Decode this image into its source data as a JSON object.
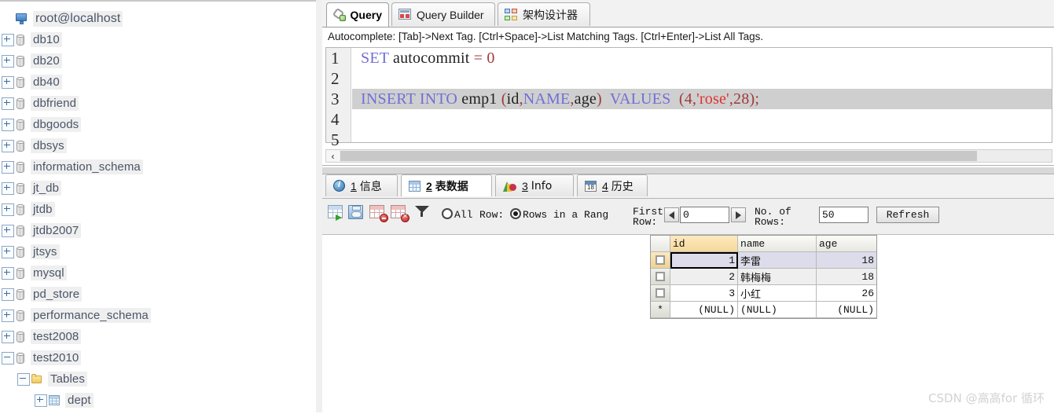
{
  "sidebar": {
    "root": {
      "label": "root@localhost",
      "icon": "monitor-icon",
      "expanded": true
    },
    "databases": [
      {
        "label": "db10",
        "icon": "database-icon",
        "toggle": "plus"
      },
      {
        "label": "db20",
        "icon": "database-icon",
        "toggle": "plus"
      },
      {
        "label": "db40",
        "icon": "database-icon",
        "toggle": "plus"
      },
      {
        "label": "dbfriend",
        "icon": "database-icon",
        "toggle": "plus"
      },
      {
        "label": "dbgoods",
        "icon": "database-icon",
        "toggle": "plus"
      },
      {
        "label": "dbsys",
        "icon": "database-icon",
        "toggle": "plus"
      },
      {
        "label": "information_schema",
        "icon": "database-icon",
        "toggle": "plus"
      },
      {
        "label": "jt_db",
        "icon": "database-icon",
        "toggle": "plus"
      },
      {
        "label": "jtdb",
        "icon": "database-icon",
        "toggle": "plus"
      },
      {
        "label": "jtdb2007",
        "icon": "database-icon",
        "toggle": "plus"
      },
      {
        "label": "jtsys",
        "icon": "database-icon",
        "toggle": "plus"
      },
      {
        "label": "mysql",
        "icon": "database-icon",
        "toggle": "plus"
      },
      {
        "label": "pd_store",
        "icon": "database-icon",
        "toggle": "plus"
      },
      {
        "label": "performance_schema",
        "icon": "database-icon",
        "toggle": "plus"
      },
      {
        "label": "test2008",
        "icon": "database-icon",
        "toggle": "plus"
      },
      {
        "label": "test2010",
        "icon": "database-icon",
        "toggle": "minus"
      }
    ],
    "tables_folder": {
      "label": "Tables",
      "icon": "folder-icon",
      "toggle": "minus"
    },
    "tables": [
      {
        "label": "dept",
        "icon": "table-icon",
        "toggle": "plus"
      }
    ]
  },
  "top_tabs": [
    {
      "label": "Query",
      "icon": "query-icon",
      "active": true
    },
    {
      "label": "Query Builder",
      "icon": "query-builder-icon",
      "active": false
    },
    {
      "label": "架构设计器",
      "icon": "schema-designer-icon",
      "active": false
    }
  ],
  "hint": "Autocomplete: [Tab]->Next Tag. [Ctrl+Space]->List Matching Tags. [Ctrl+Enter]->List All Tags.",
  "editor": {
    "line_numbers": [
      "1",
      "2",
      "3",
      "4",
      "5"
    ],
    "lines": [
      {
        "n": 1,
        "selected": false,
        "tokens": [
          {
            "t": "SET",
            "c": "k"
          },
          {
            "t": " autocommit ",
            "c": "d"
          },
          {
            "t": "=",
            "c": "p"
          },
          {
            "t": " ",
            "c": "d"
          },
          {
            "t": "0",
            "c": "n"
          }
        ]
      },
      {
        "n": 2,
        "selected": false,
        "tokens": []
      },
      {
        "n": 3,
        "selected": true,
        "tokens": [
          {
            "t": "INSERT INTO",
            "c": "k"
          },
          {
            "t": " emp1 ",
            "c": "d"
          },
          {
            "t": "(",
            "c": "p"
          },
          {
            "t": "id",
            "c": "d"
          },
          {
            "t": ",",
            "c": "p"
          },
          {
            "t": "NAME",
            "c": "k"
          },
          {
            "t": ",",
            "c": "p"
          },
          {
            "t": "age",
            "c": "d"
          },
          {
            "t": ")",
            "c": "p"
          },
          {
            "t": "  ",
            "c": "d"
          },
          {
            "t": "VALUES",
            "c": "k"
          },
          {
            "t": "  ",
            "c": "d"
          },
          {
            "t": "(",
            "c": "p"
          },
          {
            "t": "4",
            "c": "n"
          },
          {
            "t": ",",
            "c": "p"
          },
          {
            "t": "'rose'",
            "c": "s"
          },
          {
            "t": ",",
            "c": "p"
          },
          {
            "t": "28",
            "c": "n"
          },
          {
            "t": ")",
            "c": "p"
          },
          {
            "t": ";",
            "c": "p"
          }
        ]
      },
      {
        "n": 4,
        "selected": false,
        "tokens": []
      },
      {
        "n": 5,
        "selected": false,
        "tokens": []
      }
    ],
    "scroll_left_arrow": "‹"
  },
  "result_tabs": [
    {
      "num": "1",
      "label": "信息",
      "icon": "info-icon",
      "active": false
    },
    {
      "num": "2",
      "label": "表数据",
      "icon": "grid-icon",
      "active": true
    },
    {
      "num": "3",
      "label": "Info",
      "icon": "chart-icon",
      "active": false
    },
    {
      "num": "4",
      "label": "历史",
      "icon": "calendar-icon",
      "active": false
    }
  ],
  "grid_toolbar": {
    "buttons": [
      {
        "name": "add-row-button",
        "icon": "grid-add-icon"
      },
      {
        "name": "save-changes-button",
        "icon": "save-icon"
      },
      {
        "name": "delete-row-button",
        "icon": "grid-delete-icon"
      },
      {
        "name": "delete-all-rows-button",
        "icon": "grid-delete-all-icon"
      },
      {
        "name": "filter-button",
        "icon": "funnel-icon"
      }
    ],
    "radio_all_label": "All",
    "radio_all_selected": false,
    "row_label": "Row:",
    "radio_range_label": "Rows in a Rang",
    "radio_range_selected": true,
    "first_row_label": "First\nRow:",
    "first_row_value": "0",
    "no_of_rows_label": "No. of\nRows:",
    "no_of_rows_value": "50",
    "refresh_label": "Refresh",
    "prev_arrow": "◀",
    "next_arrow": "▶"
  },
  "data_grid": {
    "columns": [
      "id",
      "name",
      "age"
    ],
    "selected_column": "id",
    "rows": [
      {
        "id": "1",
        "name": "李雷",
        "age": "18",
        "current": true
      },
      {
        "id": "2",
        "name": "韩梅梅",
        "age": "18",
        "current": false
      },
      {
        "id": "3",
        "name": "小红",
        "age": "26",
        "current": false
      }
    ],
    "new_row": {
      "marker": "*",
      "id": "(NULL)",
      "name": "(NULL)",
      "age": "(NULL)"
    }
  },
  "watermark": "CSDN @高高for 循环"
}
